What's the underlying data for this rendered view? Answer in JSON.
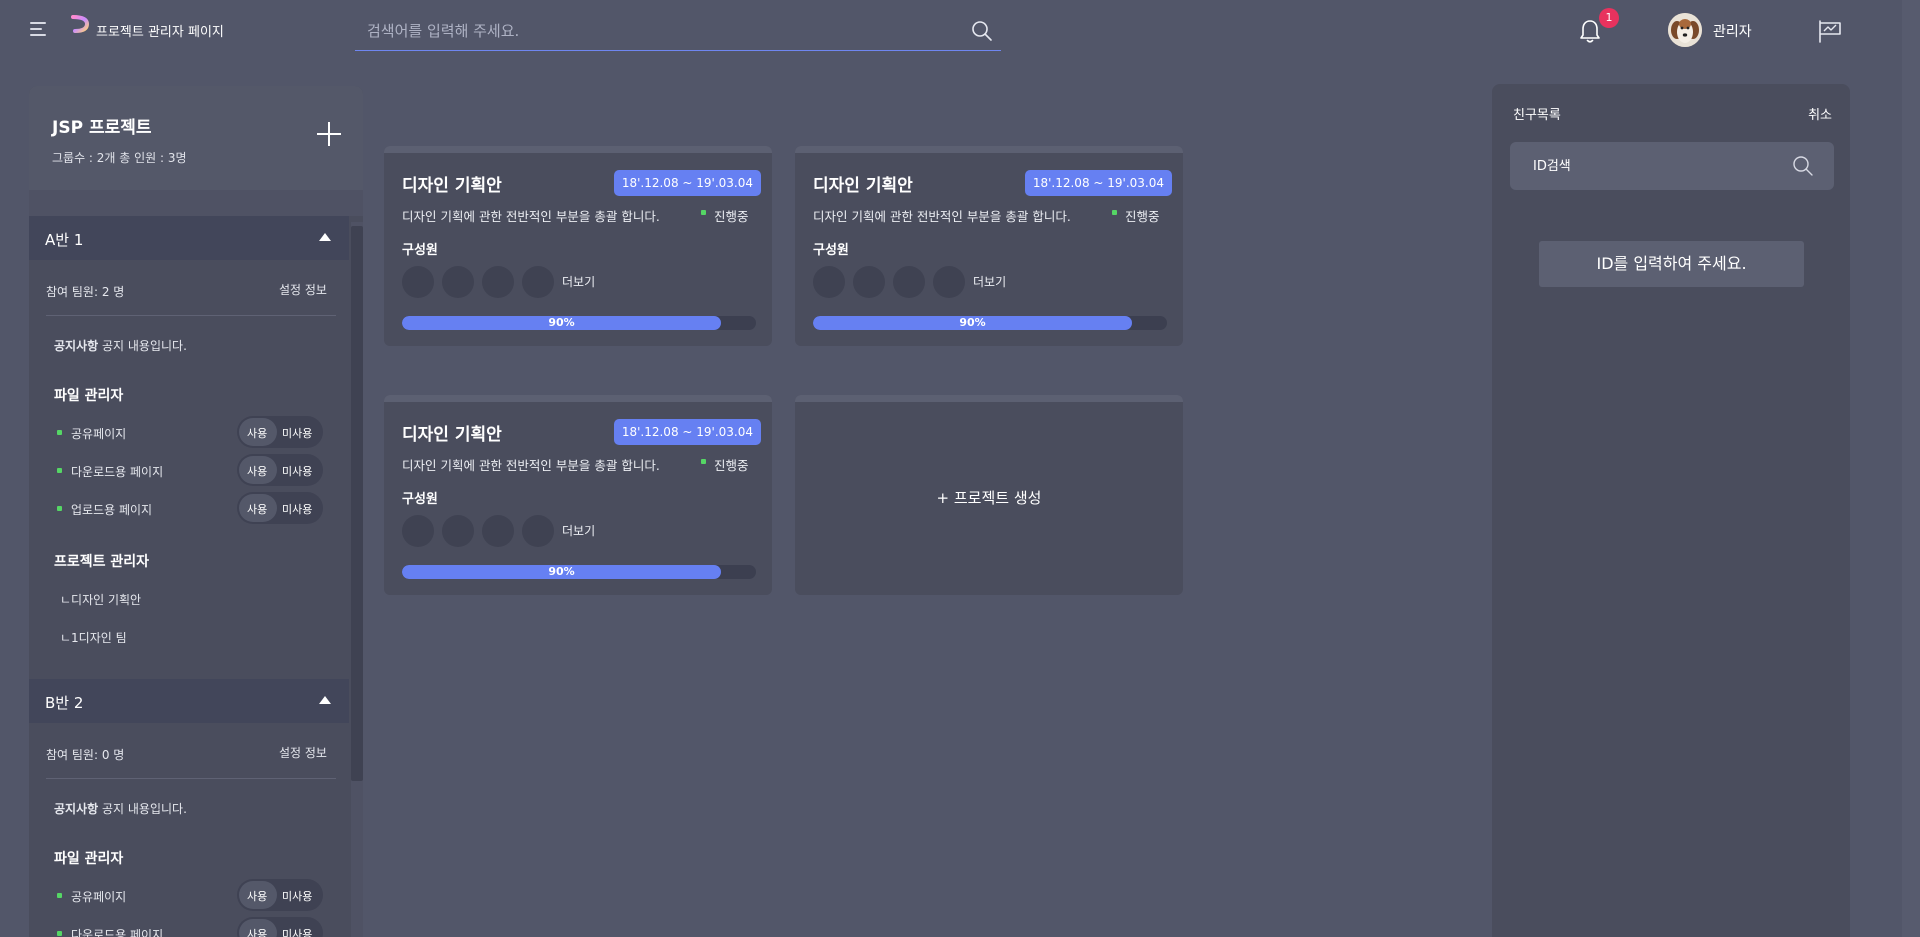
{
  "header": {
    "brand": "프로젝트 관리자 페이지",
    "search_placeholder": "검색어를 입력해 주세요.",
    "notification_count": "1",
    "user_name": "관리자"
  },
  "left_panel": {
    "project_title": "JSP 프로젝트",
    "project_stats": "그룹수 : 2개    총 인원 : 3명",
    "groups": [
      {
        "name": "A반 1",
        "members": "참여 팀원: 2 명",
        "settings_label": "설정 정보",
        "notice_label": "공지사항",
        "notice_text": "공지 내용입니다.",
        "file_manager_title": "파일 관리자",
        "files": [
          {
            "label": "공유페이지",
            "on": "사용",
            "off": "미사용"
          },
          {
            "label": "다운로드용 페이지",
            "on": "사용",
            "off": "미사용"
          },
          {
            "label": "업로드용 페이지",
            "on": "사용",
            "off": "미사용"
          }
        ],
        "project_manager_title": "프로젝트 관리자",
        "project_items": [
          "ㄴ디자인 기획안",
          "ㄴ1디자인 팀"
        ]
      },
      {
        "name": "B반 2",
        "members": "참여 팀원: 0 명",
        "settings_label": "설정 정보",
        "notice_label": "공지사항",
        "notice_text": "공지 내용입니다.",
        "file_manager_title": "파일 관리자",
        "files": [
          {
            "label": "공유페이지",
            "on": "사용",
            "off": "미사용"
          },
          {
            "label": "다운로드용 페이지",
            "on": "사용",
            "off": "미사용"
          }
        ]
      }
    ]
  },
  "cards": [
    {
      "title": "디자인 기획안",
      "date": "18'.12.08 ~ 19'.03.04",
      "description": "디자인 기획에 관한 전반적인 부분을 총괄 합니다.",
      "status": "진행중",
      "members_label": "구성원",
      "more": "더보기",
      "progress": 0.9,
      "progress_label": "90%"
    },
    {
      "title": "디자인 기획안",
      "date": "18'.12.08 ~ 19'.03.04",
      "description": "디자인 기획에 관한 전반적인 부분을 총괄 합니다.",
      "status": "진행중",
      "members_label": "구성원",
      "more": "더보기",
      "progress": 0.9,
      "progress_label": "90%"
    },
    {
      "title": "디자인 기획안",
      "date": "18'.12.08 ~ 19'.03.04",
      "description": "디자인 기획에 관한 전반적인 부분을 총괄 합니다.",
      "status": "진행중",
      "members_label": "구성원",
      "more": "더보기",
      "progress": 0.9,
      "progress_label": "90%"
    }
  ],
  "create_project": "+ 프로젝트 생성",
  "right_panel": {
    "title": "친구목록",
    "cancel": "취소",
    "id_search_placeholder": "ID검색",
    "hint": "ID를 입력하여 주세요."
  },
  "colors": {
    "background": "#525669",
    "panel": "#4a4d5d",
    "accent": "#6680f2",
    "status_green": "#55d665",
    "badge_red": "#e8325e"
  }
}
